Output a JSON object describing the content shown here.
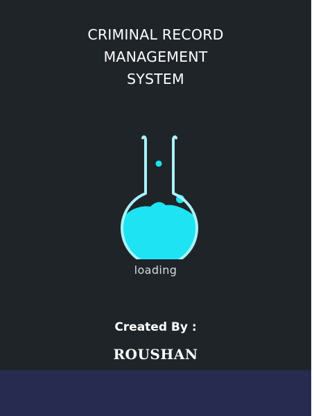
{
  "splash": {
    "title_lines": [
      "CRIMINAL RECORD",
      "MANAGEMENT",
      "SYSTEM"
    ],
    "loader_icon": "flask-icon",
    "loading_label": "loading",
    "credit_label": "Created By :",
    "author": "ROUSHAN"
  },
  "colors": {
    "background": "#1f2428",
    "footer": "#262b4f",
    "flask_liquid": "#1ee3f2",
    "flask_outline": "#a9f2f7",
    "text": "#ffffff"
  }
}
